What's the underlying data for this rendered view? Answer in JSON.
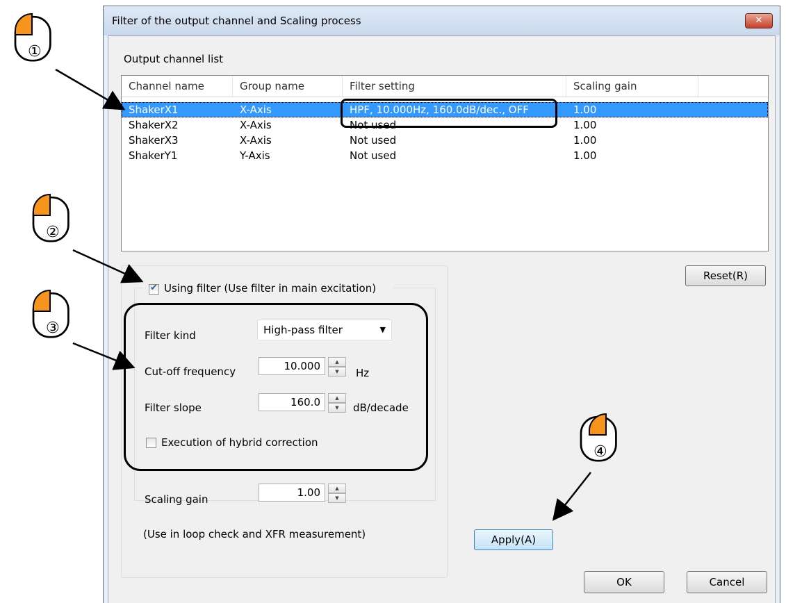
{
  "dialog": {
    "title": "Filter of the output channel and Scaling process",
    "close_label": "✕"
  },
  "list": {
    "label": "Output channel list",
    "columns": [
      "Channel name",
      "Group name",
      "Filter setting",
      "Scaling gain"
    ],
    "rows": [
      {
        "channel": "ShakerX1",
        "group": "X-Axis",
        "filter": "HPF, 10.000Hz, 160.0dB/dec., OFF",
        "gain": "1.00",
        "selected": true
      },
      {
        "channel": "ShakerX2",
        "group": "X-Axis",
        "filter": "Not used",
        "gain": "1.00"
      },
      {
        "channel": "ShakerX3",
        "group": "X-Axis",
        "filter": "Not used",
        "gain": "1.00"
      },
      {
        "channel": "ShakerY1",
        "group": "Y-Axis",
        "filter": "Not used",
        "gain": "1.00"
      }
    ]
  },
  "reset_button": "Reset(R)",
  "filter": {
    "using_filter_label": "Using filter (Use filter in main excitation)",
    "using_filter_checked": true,
    "kind_label": "Filter kind",
    "kind_value": "High-pass filter",
    "cutoff_label": "Cut-off frequency",
    "cutoff_value": "10.000",
    "cutoff_unit": "Hz",
    "slope_label": "Filter slope",
    "slope_value": "160.0",
    "slope_unit": "dB/decade",
    "hybrid_label": "Execution of hybrid correction",
    "hybrid_checked": false
  },
  "scaling": {
    "label": "Scaling gain",
    "value": "1.00",
    "note": "(Use in loop check and XFR measurement)"
  },
  "apply_button": "Apply(A)",
  "ok_button": "OK",
  "cancel_button": "Cancel",
  "callouts": [
    "①",
    "②",
    "③",
    "④"
  ],
  "colors": {
    "mouse_accent": "#f7941d",
    "selection": "#3399ff"
  }
}
